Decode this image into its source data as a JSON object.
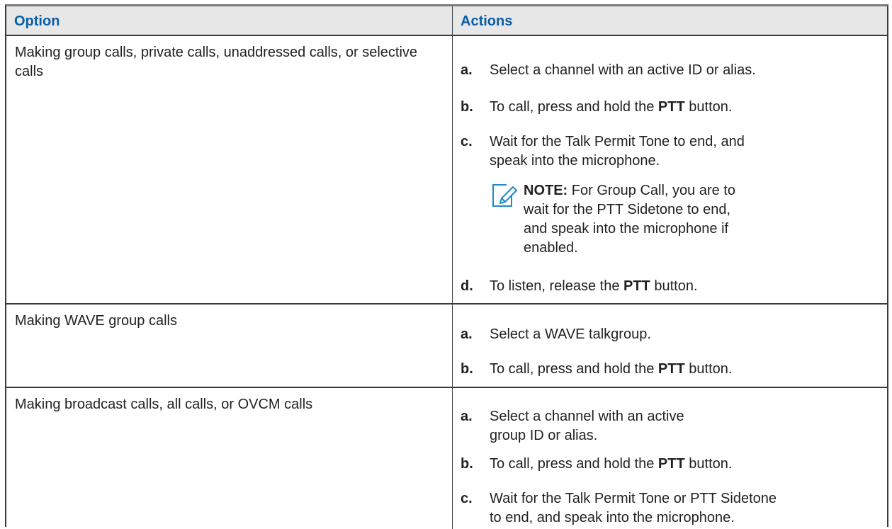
{
  "header": {
    "option": "Option",
    "actions": "Actions"
  },
  "rows": [
    {
      "option": "Making group calls, private calls, unaddressed calls, or selective calls",
      "steps": [
        {
          "letter": "a.",
          "text": "Select a channel with an active ID or alias."
        },
        {
          "letter": "b.",
          "pre": "To call, press and hold the ",
          "bold": "PTT",
          "post": " button."
        },
        {
          "letter": "c.",
          "text": "Wait for the Talk Permit Tone to end, and speak into the microphone."
        },
        {
          "letter": "d.",
          "pre": "To listen, release the ",
          "bold": "PTT",
          "post": " button."
        }
      ],
      "note": {
        "label": "NOTE:",
        "text": " For Group Call, you are to wait for the PTT Sidetone to end, and speak into the microphone if en­abled."
      }
    },
    {
      "option": "Making WAVE group calls",
      "steps": [
        {
          "letter": "a.",
          "text": "Select a WAVE talkgroup."
        },
        {
          "letter": "b.",
          "pre": "To call, press and hold the ",
          "bold": "PTT",
          "post": " button."
        }
      ]
    },
    {
      "option": "Making broadcast calls, all calls, or OVCM calls",
      "steps": [
        {
          "letter": "a.",
          "text": "Select a channel with an active group ID or alias."
        },
        {
          "letter": "b.",
          "pre": "To call, press and hold the ",
          "bold": "PTT",
          "post": " button."
        },
        {
          "letter": "c.",
          "text": "Wait for the Talk Permit Tone or PTT Side­tone to end, and speak into the microphone."
        }
      ]
    }
  ],
  "icons": {
    "note": "note-pencil-icon"
  },
  "colors": {
    "header_text": "#0a5ea8",
    "header_bg": "#e7e7e7",
    "note_icon": "#1f8ac9"
  }
}
